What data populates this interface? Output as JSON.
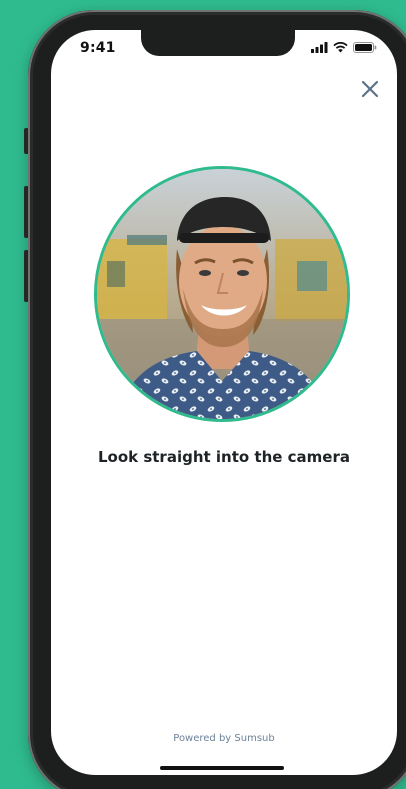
{
  "status_bar": {
    "time": "9:41",
    "icons": [
      "signal-icon",
      "wifi-icon",
      "battery-icon"
    ]
  },
  "header": {
    "close_icon": "close-icon"
  },
  "selfie": {
    "photo": "face-photo",
    "ring_color": "#2fbb8e"
  },
  "instruction": {
    "text": "Look straight into the camera"
  },
  "footer": {
    "powered_by": "Powered by Sumsub"
  },
  "colors": {
    "background": "#2fbb8e",
    "accent": "#2fbb8e",
    "close_icon": "#5d7387"
  }
}
